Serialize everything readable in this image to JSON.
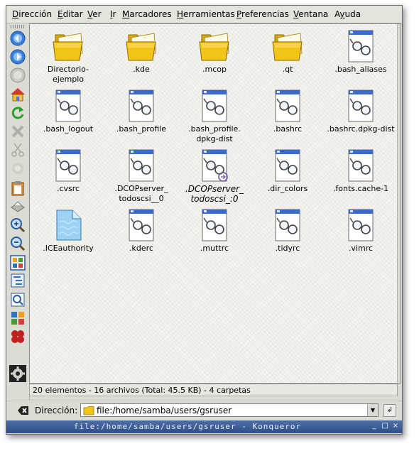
{
  "menu": {
    "items": [
      {
        "pre": "",
        "u": "D",
        "post": "irección"
      },
      {
        "pre": "",
        "u": "E",
        "post": "ditar"
      },
      {
        "pre": "",
        "u": "V",
        "post": "er"
      },
      {
        "pre": "",
        "u": "I",
        "post": "r"
      },
      {
        "pre": "",
        "u": "M",
        "post": "arcadores"
      },
      {
        "pre": "",
        "u": "H",
        "post": "erramientas"
      },
      {
        "pre": "",
        "u": "P",
        "post": "referencias"
      },
      {
        "pre": "",
        "u": "V",
        "post": "entana"
      },
      {
        "pre": "A",
        "u": "y",
        "post": "uda"
      }
    ]
  },
  "toolbar_icons": [
    "back-icon",
    "forward-icon",
    "stop-icon",
    "home-icon",
    "reload-icon",
    "delete-icon",
    "cut-icon",
    "copy-icon",
    "paste-icon",
    "print-icon",
    "zoom-in-icon",
    "zoom-out-icon",
    "icon-view-icon",
    "tree-view-icon",
    "detail-view-icon",
    "thumbnail-view-icon",
    "konqueror-logo-icon",
    "settings-gear-icon"
  ],
  "files": [
    {
      "name": "Directorio-ejemplo",
      "lines": [
        "Directorio-",
        "ejemplo"
      ],
      "type": "folder"
    },
    {
      "name": ".kde",
      "lines": [
        ".kde"
      ],
      "type": "folder"
    },
    {
      "name": ".mcop",
      "lines": [
        ".mcop"
      ],
      "type": "folder"
    },
    {
      "name": ".qt",
      "lines": [
        ".qt"
      ],
      "type": "folder"
    },
    {
      "name": ".bash_aliases",
      "lines": [
        ".bash_aliases"
      ],
      "type": "text"
    },
    {
      "name": ".bash_logout",
      "lines": [
        ".bash_logout"
      ],
      "type": "text"
    },
    {
      "name": ".bash_profile",
      "lines": [
        ".bash_profile"
      ],
      "type": "text"
    },
    {
      "name": ".bash_profile.dpkg-dist",
      "lines": [
        ".bash_profile.",
        "dpkg-dist"
      ],
      "type": "text"
    },
    {
      "name": ".bashrc",
      "lines": [
        ".bashrc"
      ],
      "type": "text"
    },
    {
      "name": ".bashrc.dpkg-dist",
      "lines": [
        ".bashrc.dpkg-dist"
      ],
      "type": "text"
    },
    {
      "name": ".cvsrc",
      "lines": [
        ".cvsrc"
      ],
      "type": "text"
    },
    {
      "name": ".DCOPserver_todoscsi__0",
      "lines": [
        ".DCOPserver_",
        "todoscsi__0"
      ],
      "type": "text"
    },
    {
      "name": ".DCOPserver_todoscsi_:0",
      "lines": [
        ".DCOPserver_",
        "todoscsi_:0"
      ],
      "type": "link"
    },
    {
      "name": ".dir_colors",
      "lines": [
        ".dir_colors"
      ],
      "type": "text"
    },
    {
      "name": ".fonts.cache-1",
      "lines": [
        ".fonts.cache-1"
      ],
      "type": "text"
    },
    {
      "name": ".ICEauthority",
      "lines": [
        ".ICEauthority"
      ],
      "type": "binary"
    },
    {
      "name": ".kderc",
      "lines": [
        ".kderc"
      ],
      "type": "text"
    },
    {
      "name": ".muttrc",
      "lines": [
        ".muttrc"
      ],
      "type": "text"
    },
    {
      "name": ".tidyrc",
      "lines": [
        ".tidyrc"
      ],
      "type": "text"
    },
    {
      "name": ".vimrc",
      "lines": [
        ".vimrc"
      ],
      "type": "text"
    }
  ],
  "status": {
    "text": "20 elementos - 16 archivos (Total: 45.5 KB) - 4 carpetas"
  },
  "location": {
    "label": "Dirección:",
    "value": "file:/home/samba/users/gsruser"
  },
  "window": {
    "title": "file:/home/samba/users/gsruser - Konqueror",
    "controls": [
      "_",
      "□",
      "×"
    ]
  },
  "colors": {
    "folder": "#f2c418",
    "titlebar": "#3a5a94",
    "content_bg": "#f4f3ee"
  }
}
